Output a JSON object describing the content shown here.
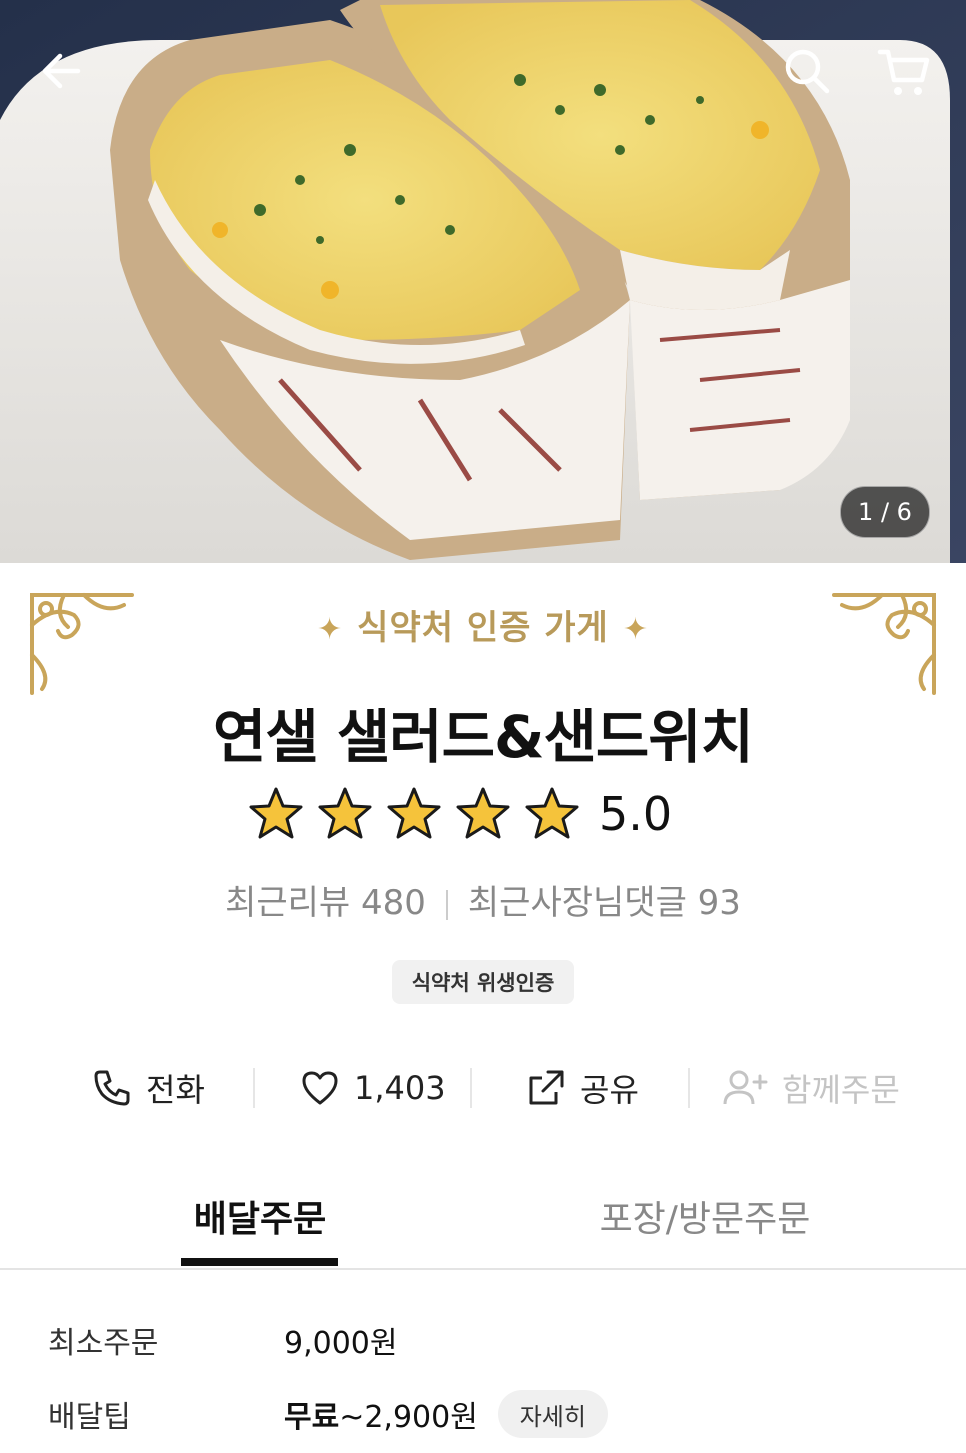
{
  "header": {
    "back_icon": "arrow-left-icon",
    "search_icon": "search-icon",
    "cart_icon": "cart-icon",
    "image_counter": "1 / 6"
  },
  "store": {
    "cert_title": "식약처 인증 가게",
    "name": "연샐 샐러드&샌드위치",
    "rating": {
      "stars": 5,
      "max": 5,
      "score": "5.0"
    },
    "recent_reviews": "최근리뷰 480",
    "owner_replies": "최근사장님댓글 93",
    "badge": "식약처 위생인증"
  },
  "actions": [
    {
      "label": "전화",
      "icon": "phone-icon"
    },
    {
      "label": "1,403",
      "icon": "heart-icon"
    },
    {
      "label": "공유",
      "icon": "share-icon"
    },
    {
      "label": "함께주문",
      "icon": "add-user-icon",
      "disabled": true
    }
  ],
  "tabs": [
    {
      "label": "배달주문",
      "active": true
    },
    {
      "label": "포장/방문주문",
      "active": false
    }
  ],
  "delivery_info": {
    "min_order_label": "최소주문",
    "min_order_value": "9,000원",
    "tip_label": "배달팁",
    "tip_free": "무료",
    "tip_range": "~2,900원",
    "detail_button": "자세히"
  },
  "colors": {
    "gold": "#b89a5a",
    "star_fill": "#f5c33b",
    "text_muted": "#888888"
  }
}
